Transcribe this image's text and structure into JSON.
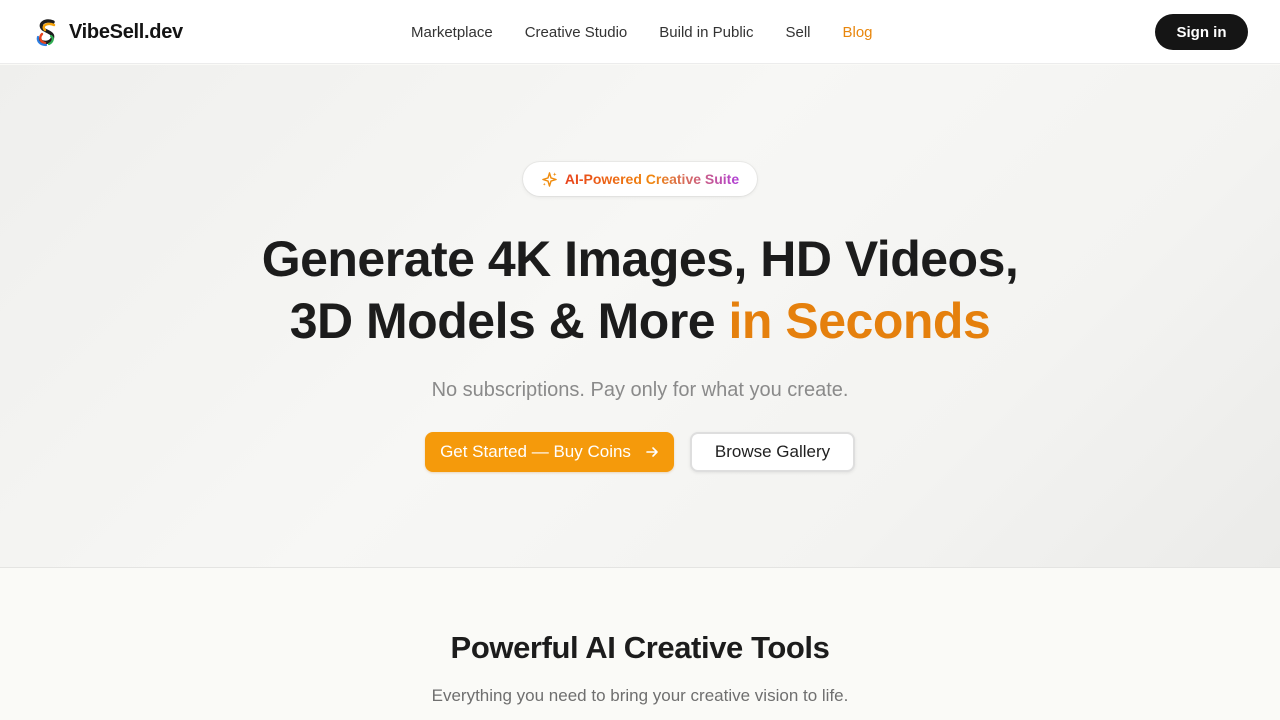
{
  "header": {
    "brand_name": "VibeSell.dev",
    "nav": [
      {
        "label": "Marketplace"
      },
      {
        "label": "Creative Studio"
      },
      {
        "label": "Build in Public"
      },
      {
        "label": "Sell"
      },
      {
        "label": "Blog",
        "active": true
      }
    ],
    "signin_label": "Sign in",
    "brand_logo_icon": "s-swirl-logo-icon"
  },
  "hero": {
    "badge_icon": "sparkles-icon",
    "badge_text": "AI-Powered Creative Suite",
    "headline_line1": "Generate 4K Images, HD Videos,",
    "headline_line2": "3D Models & More",
    "headline_accent": "in Seconds",
    "subheadline": "No subscriptions. Pay only for what you create.",
    "cta_primary_label": "Get Started — Buy Coins",
    "cta_primary_icon": "arrow-right-icon",
    "cta_secondary_label": "Browse Gallery"
  },
  "features": {
    "title": "Powerful AI Creative Tools",
    "subtitle": "Everything you need to bring your creative vision to life."
  },
  "colors": {
    "accent": "#e5800d",
    "cta": "#f59a0b",
    "dark": "#151515",
    "background": "#fafaf7"
  }
}
